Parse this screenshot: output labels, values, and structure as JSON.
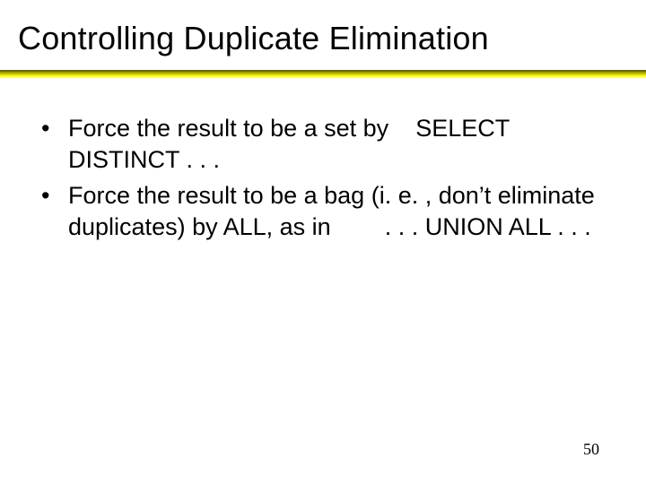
{
  "title": "Controlling Duplicate Elimination",
  "bullets": [
    "Force the result to be a set by    SELECT DISTINCT . . .",
    "Force the result to be a bag (i. e. , don’t eliminate duplicates) by ALL, as in        . . . UNION ALL . . ."
  ],
  "page_number": "50"
}
